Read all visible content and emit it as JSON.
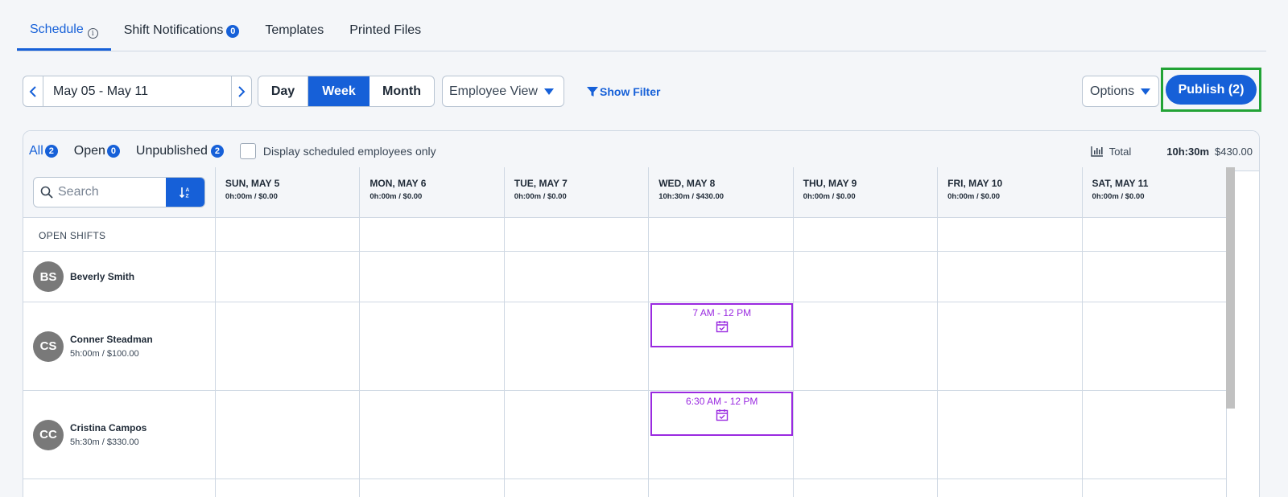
{
  "top_tabs": {
    "schedule": "Schedule",
    "info_icon": "i",
    "shift_notifications": "Shift Notifications",
    "shift_notifications_count": "0",
    "templates": "Templates",
    "printed_files": "Printed Files"
  },
  "toolbar": {
    "date_range": "May 05 - May 11",
    "views": {
      "day": "Day",
      "week": "Week",
      "month": "Month",
      "selected": "Week"
    },
    "view_select": "Employee View",
    "show_filter": "Show Filter",
    "options": "Options",
    "publish": "Publish (2)"
  },
  "panel": {
    "tabs": [
      {
        "label": "All",
        "count": "2"
      },
      {
        "label": "Open",
        "count": "0"
      },
      {
        "label": "Unpublished",
        "count": "2"
      }
    ],
    "display_scheduled_only": "Display scheduled employees only",
    "total_label": "Total",
    "total_hours": "10h:30m",
    "total_cost": "$430.00"
  },
  "grid": {
    "search_placeholder": "Search",
    "days": [
      {
        "name": "SUN, MAY 5",
        "total": "0h:00m / $0.00"
      },
      {
        "name": "MON, MAY 6",
        "total": "0h:00m / $0.00"
      },
      {
        "name": "TUE, MAY 7",
        "total": "0h:00m / $0.00"
      },
      {
        "name": "WED, MAY 8",
        "total": "10h:30m / $430.00"
      },
      {
        "name": "THU, MAY 9",
        "total": "0h:00m / $0.00"
      },
      {
        "name": "FRI, MAY 10",
        "total": "0h:00m / $0.00"
      },
      {
        "name": "SAT, MAY 11",
        "total": "0h:00m / $0.00"
      }
    ],
    "open_shifts_label": "OPEN SHIFTS",
    "employees": [
      {
        "initials": "BS",
        "name": "Beverly Smith",
        "meta": ""
      },
      {
        "initials": "CS",
        "name": "Conner Steadman",
        "meta": "5h:00m / $100.00"
      },
      {
        "initials": "CC",
        "name": "Cristina Campos",
        "meta": "5h:30m / $330.00"
      }
    ],
    "shifts": [
      {
        "employee": "Conner Steadman",
        "day": "WED, MAY 8",
        "time": "7 AM - 12 PM",
        "icon": "calendar-check-icon"
      },
      {
        "employee": "Cristina Campos",
        "day": "WED, MAY 8",
        "time": "6:30 AM - 12 PM",
        "icon": "calendar-check-icon"
      }
    ]
  },
  "colors": {
    "accent": "#1660d8",
    "shift_unpublished": "#9a2ae0",
    "publish_highlight": "#22a336",
    "avatar_bg": "#797979"
  }
}
